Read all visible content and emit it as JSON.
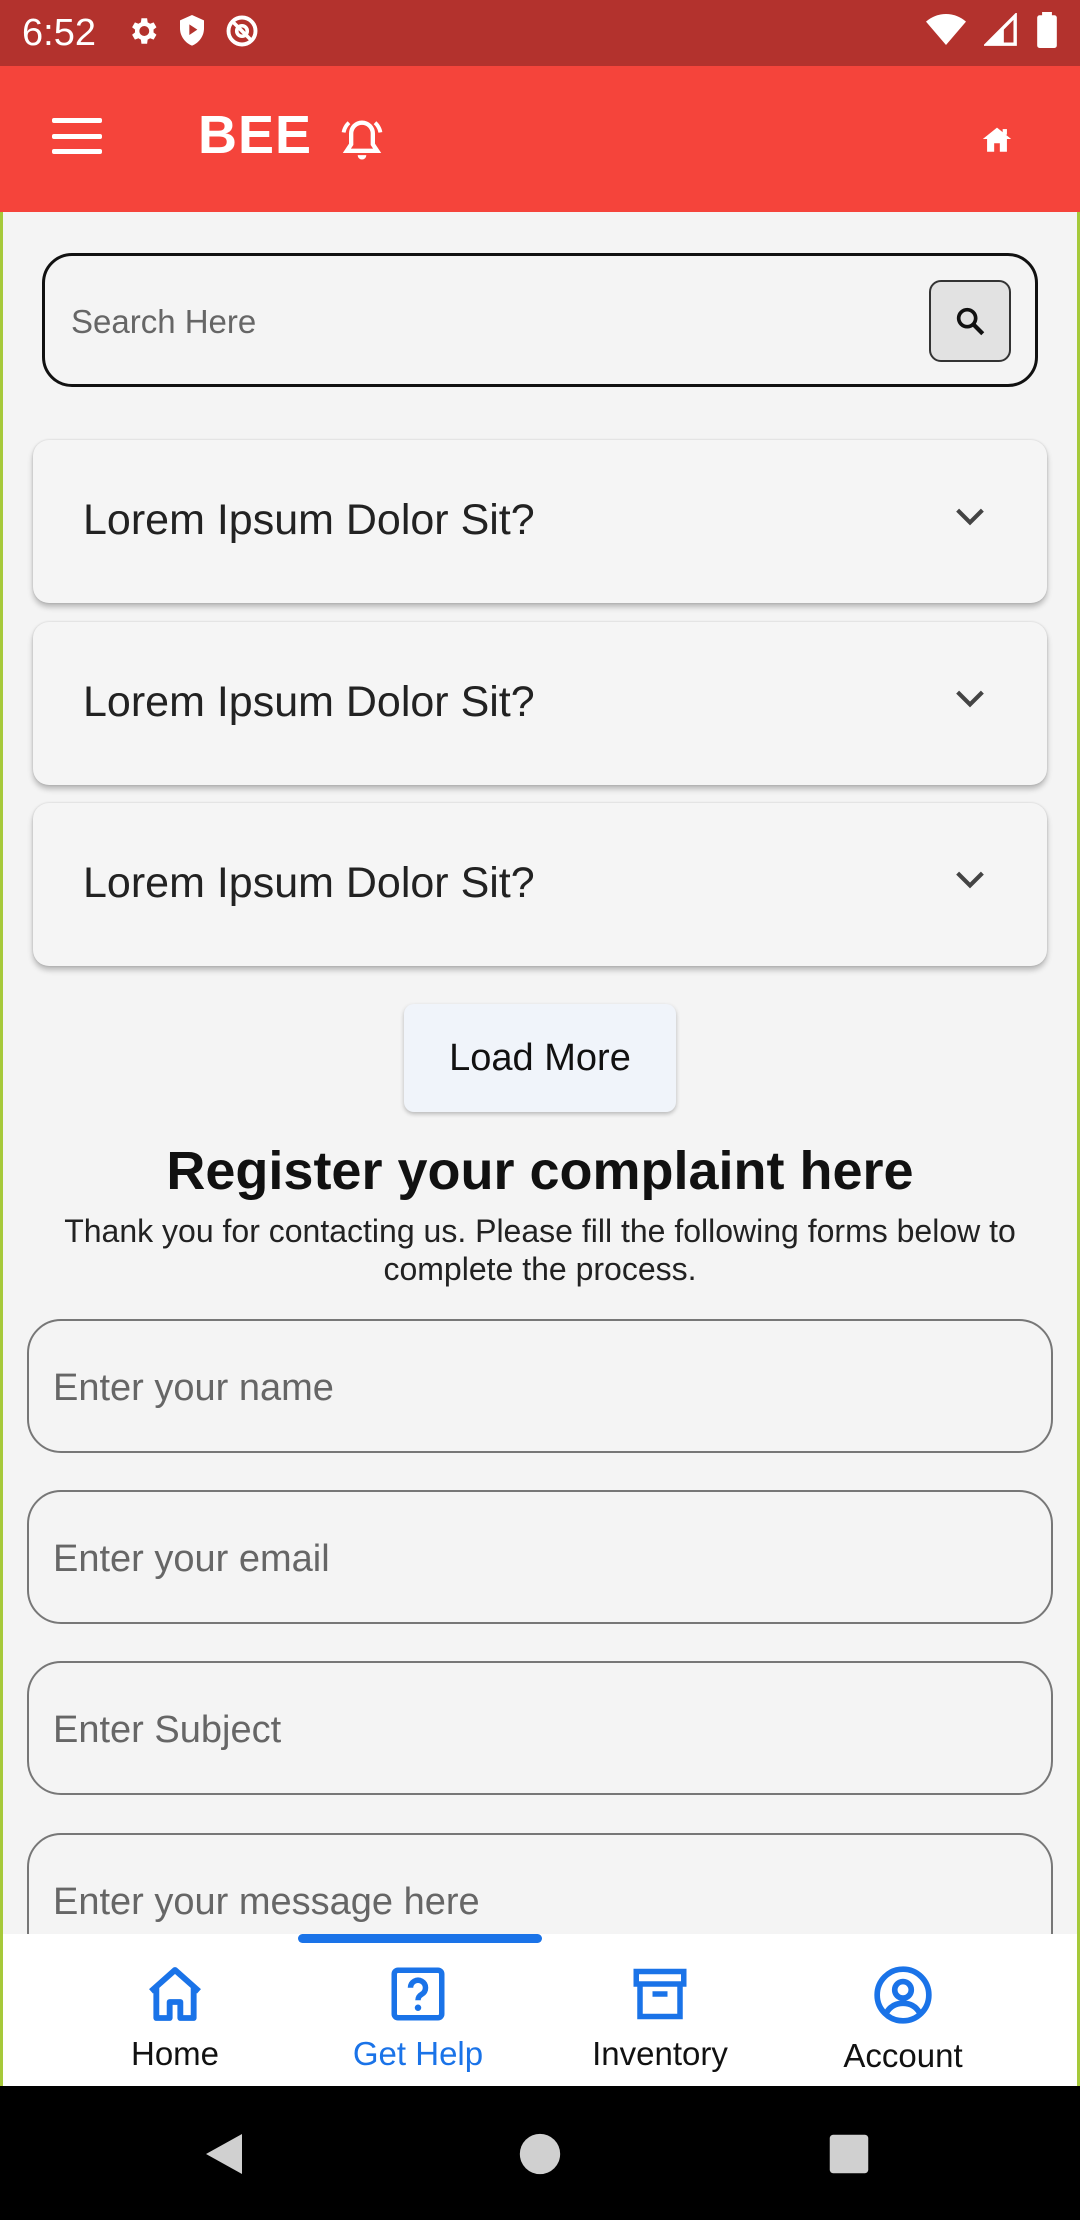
{
  "status_bar": {
    "time": "6:52"
  },
  "app_bar": {
    "title": "BEE"
  },
  "search": {
    "placeholder": "Search Here"
  },
  "faq": [
    {
      "question": "Lorem Ipsum Dolor Sit?"
    },
    {
      "question": "Lorem Ipsum Dolor Sit?"
    },
    {
      "question": "Lorem Ipsum Dolor Sit?"
    }
  ],
  "load_more_label": "Load More",
  "complaint": {
    "title": "Register your complaint here",
    "subtitle": "Thank you for contacting us. Please fill the following forms below to complete the process.",
    "name_placeholder": "Enter your name",
    "email_placeholder": "Enter your email",
    "subject_placeholder": "Enter Subject",
    "message_placeholder": "Enter your message here"
  },
  "bottom_nav": {
    "items": [
      {
        "label": "Home",
        "icon": "home-icon"
      },
      {
        "label": "Get Help",
        "icon": "help-icon",
        "active": true
      },
      {
        "label": "Inventory",
        "icon": "archive-icon"
      },
      {
        "label": "Account",
        "icon": "account-icon"
      }
    ]
  },
  "colors": {
    "status_bar": "#b3322d",
    "app_bar": "#f5443b",
    "accent": "#1a73e8"
  }
}
